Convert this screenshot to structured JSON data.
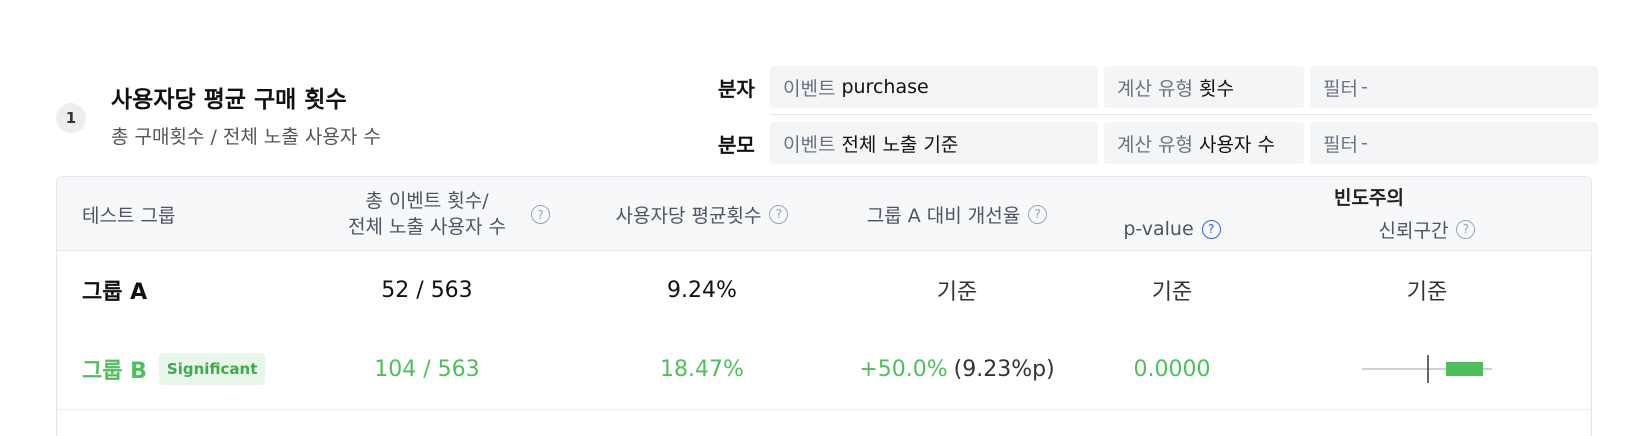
{
  "metric": {
    "index": "1",
    "title": "사용자당 평균 구매 횟수",
    "subtitle": "총 구매횟수 / 전체 노출 사용자 수"
  },
  "numerator": {
    "label": "분자",
    "event_key": "이벤트",
    "event_value": "purchase",
    "calc_key": "계산 유형",
    "calc_value": "횟수",
    "filter_key": "필터",
    "filter_value": "-"
  },
  "denominator": {
    "label": "분모",
    "event_key": "이벤트",
    "event_value": "전체 노출 기준",
    "calc_key": "계산 유형",
    "calc_value": "사용자 수",
    "filter_key": "필터",
    "filter_value": "-"
  },
  "table": {
    "headers": {
      "group": "테스트 그룹",
      "total_line1": "총 이벤트 횟수/",
      "total_line2": "전체 노출 사용자 수",
      "avg": "사용자당 평균횟수",
      "improvement": "그룹 A 대비 개선율",
      "frequentist": "빈도주의",
      "pvalue": "p-value",
      "ci": "신뢰구간"
    },
    "rows": [
      {
        "group": "그룹 A",
        "ratio": "52 / 563",
        "avg": "9.24%",
        "improvement": "기준",
        "improvement_diff": "",
        "pvalue": "기준",
        "ci": "기준"
      },
      {
        "group": "그룹 B",
        "badge": "Significant",
        "ratio": "104 / 563",
        "avg": "18.47%",
        "improvement": "+50.0%",
        "improvement_diff": "(9.23%p)",
        "pvalue": "0.0000"
      }
    ]
  },
  "colors": {
    "significant": "#4fbf5c",
    "header_bg": "#f7f8fa",
    "help_blue": "#3b5bdb"
  }
}
